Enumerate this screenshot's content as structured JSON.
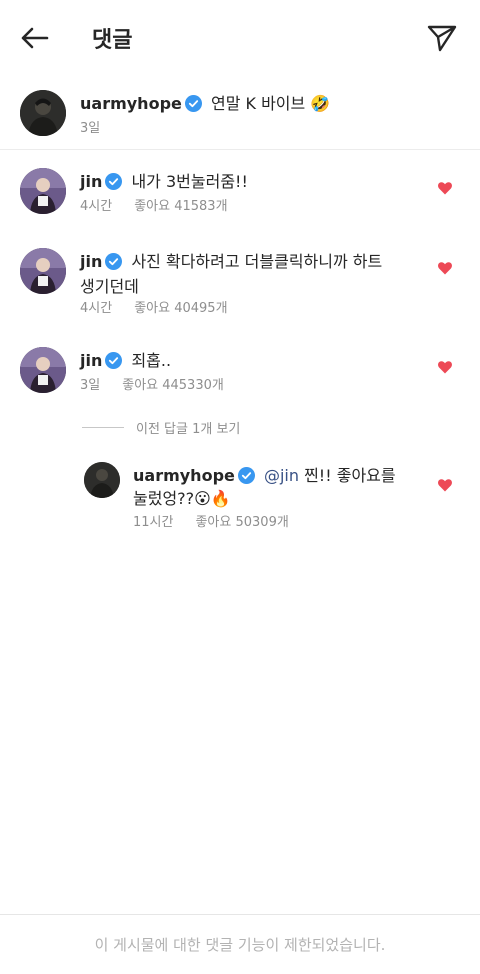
{
  "header": {
    "title": "댓글",
    "back_icon": "back-arrow-icon",
    "send_icon": "send-icon"
  },
  "caption": {
    "username": "uarmyhope",
    "text": "연말 K 바이브 🤣",
    "time": "3일"
  },
  "comments": [
    {
      "username": "jin",
      "text": "내가 3번눌러줌!!",
      "text_cont": "",
      "time": "4시간",
      "likes": "좋아요 41583개"
    },
    {
      "username": "jin",
      "text": "사진 확다하려고 더블클릭하니까 하트",
      "text_cont": "생기던데",
      "time": "4시간",
      "likes": "좋아요 40495개"
    },
    {
      "username": "jin",
      "text": "죄홉..",
      "text_cont": "",
      "time": "3일",
      "likes": "좋아요 445330개"
    }
  ],
  "view_replies": "이전 답글 1개 보기",
  "reply": {
    "username": "uarmyhope",
    "mention": "@jin",
    "text": " 찐!! 좋아요를",
    "text_cont": "눌렀엉??😮🔥",
    "time": "11시간",
    "likes": "좋아요 50309개"
  },
  "footer": {
    "notice": "이 게시물에 대한 댓글 기능이 제한되었습니다."
  },
  "colors": {
    "heart": "#ed4956",
    "verified": "#3897f0",
    "secondary_text": "#8e8e8e",
    "mention": "#385185"
  }
}
